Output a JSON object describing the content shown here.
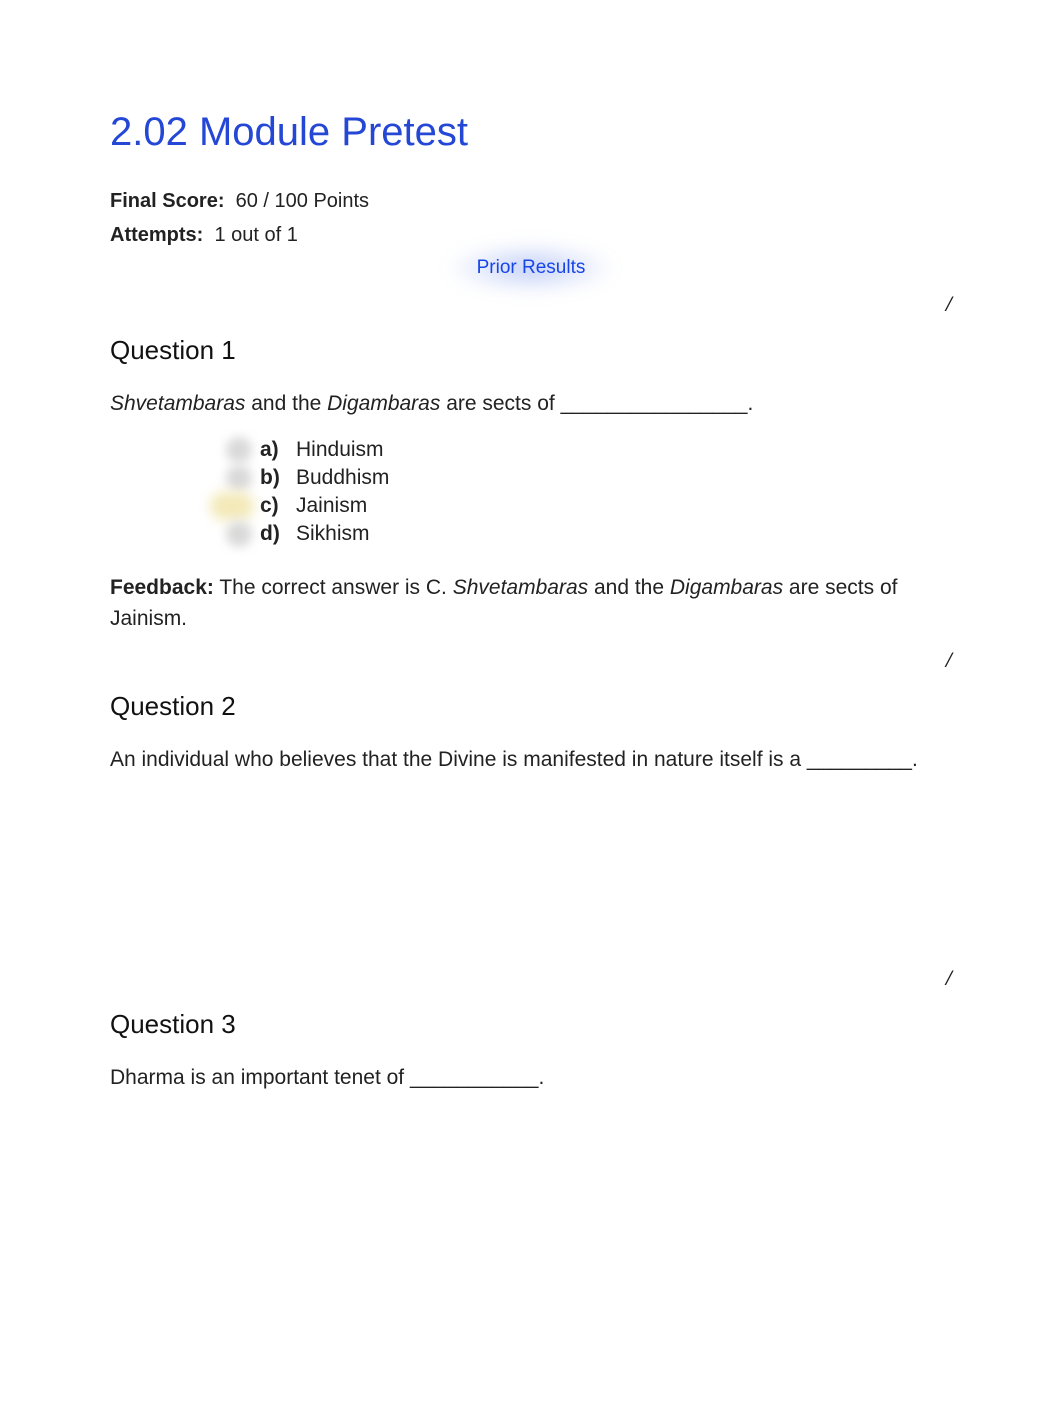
{
  "title": "2.02 Module Pretest",
  "score": {
    "label": "Final Score:",
    "value": "60 / 100 Points"
  },
  "attempts": {
    "label": "Attempts:",
    "value": "1 out of 1"
  },
  "priorResults": "Prior Results",
  "slash": "/",
  "questions": [
    {
      "heading": "Question 1",
      "text_pre_italic1": "",
      "italic1": "Shvetambaras",
      "text_mid": " and the ",
      "italic2": "Digambaras",
      "text_post": " are sects of ________________.",
      "choices": [
        {
          "letter": "a)",
          "text": "Hinduism",
          "hl": false
        },
        {
          "letter": "b)",
          "text": "Buddhism",
          "hl": false
        },
        {
          "letter": "c)",
          "text": "Jainism",
          "hl": true
        },
        {
          "letter": "d)",
          "text": "Sikhism",
          "hl": false
        }
      ],
      "feedback": {
        "label": "Feedback:",
        "pre": " The correct answer is C. ",
        "italic1": "Shvetambaras",
        "mid": " and the ",
        "italic2": "Digambaras",
        "post": " are sects of Jainism."
      }
    },
    {
      "heading": "Question 2",
      "plain_text": "An individual who believes that the Divine is manifested in nature itself is a _________."
    },
    {
      "heading": "Question 3",
      "plain_text": "Dharma is an important tenet of ___________."
    }
  ]
}
